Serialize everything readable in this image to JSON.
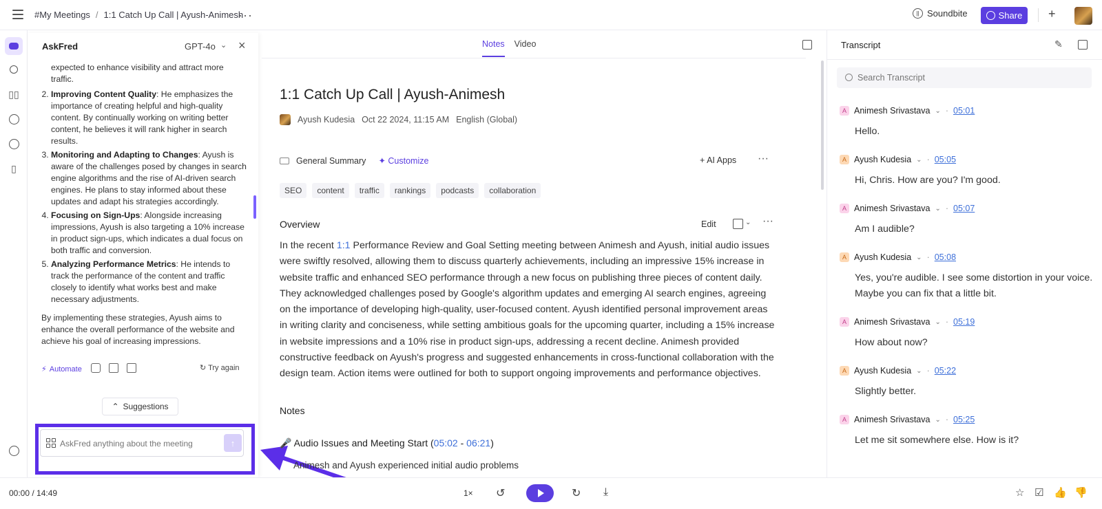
{
  "breadcrumb": {
    "root": "#My Meetings",
    "separator": "/",
    "current": "1:1 Catch Up Call | Ayush-Animesh"
  },
  "header": {
    "soundbite_label": "Soundbite",
    "share_label": "Share"
  },
  "askfred": {
    "title": "AskFred",
    "model": "GPT-4o",
    "clipped_intro": "expected to enhance visibility and attract more traffic.",
    "items": [
      {
        "num": "2.",
        "title": "Improving Content Quality",
        "text": ": He emphasizes the importance of creating helpful and high-quality content. By continually working on writing better content, he believes it will rank higher in search results."
      },
      {
        "num": "3.",
        "title": "Monitoring and Adapting to Changes",
        "text": ": Ayush is aware of the challenges posed by changes in search engine algorithms and the rise of AI-driven search engines. He plans to stay informed about these updates and adapt his strategies accordingly."
      },
      {
        "num": "4.",
        "title": "Focusing on Sign-Ups",
        "text": ": Alongside increasing impressions, Ayush is also targeting a 10% increase in product sign-ups, which indicates a dual focus on both traffic and conversion."
      },
      {
        "num": "5.",
        "title": "Analyzing Performance Metrics",
        "text": ": He intends to track the performance of the content and traffic closely to identify what works best and make necessary adjustments."
      }
    ],
    "conclusion": "By implementing these strategies, Ayush aims to enhance the overall performance of the website and achieve his goal of increasing impressions.",
    "automate_label": "Automate",
    "try_again_label": "Try again",
    "suggestions_label": "Suggestions",
    "input_placeholder": "AskFred anything about the meeting"
  },
  "center": {
    "tabs": [
      {
        "label": "Notes"
      },
      {
        "label": "Video"
      }
    ],
    "title": "1:1 Catch Up Call | Ayush-Animesh",
    "meta": {
      "author": "Ayush Kudesia",
      "date": "Oct 22 2024, 11:15 AM",
      "language": "English (Global)"
    },
    "summary_label": "General Summary",
    "customize_label": "Customize",
    "ai_apps_label": "+ AI Apps",
    "tags": [
      "SEO",
      "content",
      "traffic",
      "rankings",
      "podcasts",
      "collaboration"
    ],
    "overview_title": "Overview",
    "edit_label": "Edit",
    "overview_pre": "In the recent ",
    "overview_link": "1:1",
    "overview_post": " Performance Review and Goal Setting meeting between Animesh and Ayush, initial audio issues were swiftly resolved, allowing them to discuss quarterly achievements, including an impressive 15% increase in website traffic and enhanced SEO performance through a new focus on publishing three pieces of content daily. They acknowledged challenges posed by Google's algorithm updates and emerging AI search engines, agreeing on the importance of developing high-quality, user-focused content. Ayush identified personal improvement areas in writing clarity and conciseness, while setting ambitious goals for the upcoming quarter, including a 15% increase in website impressions and a 10% rise in product sign-ups, addressing a recent decline. Animesh provided constructive feedback on Ayush's progress and suggested enhancements in cross-functional collaboration with the design team. Action items were outlined for both to support ongoing improvements and performance objectives.",
    "notes_title": "Notes",
    "note_section": {
      "emoji": "🎤",
      "title": "Audio Issues and Meeting Start (",
      "start": "05:02",
      "dash": " - ",
      "end": "06:21",
      "close": ")"
    },
    "note_bullet": "Animesh and Ayush experienced initial audio problems"
  },
  "transcript": {
    "title": "Transcript",
    "search_placeholder": "Search Transcript",
    "entries": [
      {
        "initial": "A",
        "speaker": "Animesh Srivastava",
        "time": "05:01",
        "text": "Hello.",
        "color": "pink"
      },
      {
        "initial": "A",
        "speaker": "Ayush Kudesia",
        "time": "05:05",
        "text": "Hi, Chris. How are you? I'm good.",
        "color": "orange"
      },
      {
        "initial": "A",
        "speaker": "Animesh Srivastava",
        "time": "05:07",
        "text": "Am I audible?",
        "color": "pink"
      },
      {
        "initial": "A",
        "speaker": "Ayush Kudesia",
        "time": "05:08",
        "text": "Yes, you're audible. I see some distortion in your voice. Maybe you can fix that a little bit.",
        "color": "orange"
      },
      {
        "initial": "A",
        "speaker": "Animesh Srivastava",
        "time": "05:19",
        "text": "How about now?",
        "color": "pink"
      },
      {
        "initial": "A",
        "speaker": "Ayush Kudesia",
        "time": "05:22",
        "text": "Slightly better.",
        "color": "orange"
      },
      {
        "initial": "A",
        "speaker": "Animesh Srivastava",
        "time": "05:25",
        "text": "Let me sit somewhere else. How is it?",
        "color": "pink"
      }
    ]
  },
  "player": {
    "time": "00:00 / 14:49",
    "speed": "1×"
  },
  "colors": {
    "accent": "#5b3ee0",
    "link": "#3d6fd9",
    "highlight": "#5b2ee8"
  }
}
